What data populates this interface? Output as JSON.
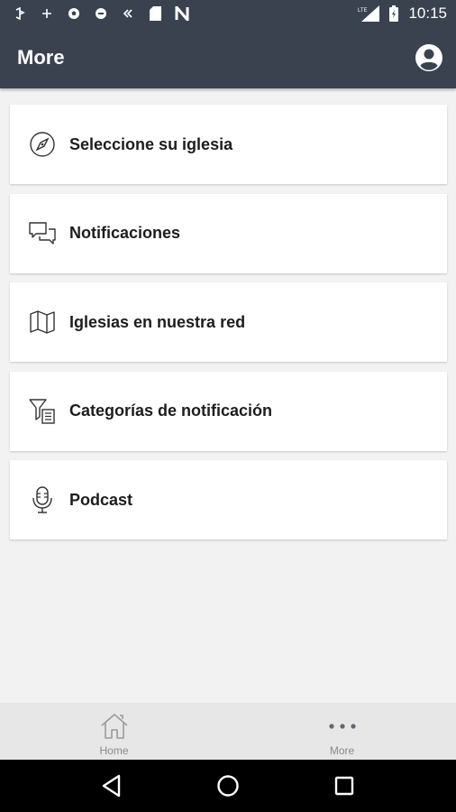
{
  "status_bar": {
    "time": "10:15",
    "network_label": "LTE",
    "icons": [
      "bluetooth-share-icon",
      "plus-icon",
      "soccer-ball-icon",
      "record-icon",
      "double-chevron-icon",
      "sd-card-icon",
      "n-icon",
      "signal-icon",
      "battery-icon"
    ]
  },
  "app_bar": {
    "title": "More",
    "profile_icon": "account-circle-icon"
  },
  "menu": {
    "items": [
      {
        "label": "Seleccione su iglesia",
        "icon": "compass-icon"
      },
      {
        "label": "Notificaciones",
        "icon": "chat-bubbles-icon"
      },
      {
        "label": "Iglesias en nuestra red",
        "icon": "map-icon"
      },
      {
        "label": "Categorías de notificación",
        "icon": "filter-list-icon"
      },
      {
        "label": "Podcast",
        "icon": "microphone-icon"
      }
    ]
  },
  "bottom_nav": {
    "items": [
      {
        "label": "Home",
        "icon": "home-icon"
      },
      {
        "label": "More",
        "icon": "more-dots-icon"
      }
    ],
    "active": "More"
  },
  "system_nav": {
    "buttons": [
      "back-icon",
      "home-circle-icon",
      "recents-icon"
    ]
  },
  "colors": {
    "app_bar": "#3a4250",
    "background": "#f2f2f2",
    "card": "#ffffff",
    "nav_bar": "#e7e7e7"
  }
}
